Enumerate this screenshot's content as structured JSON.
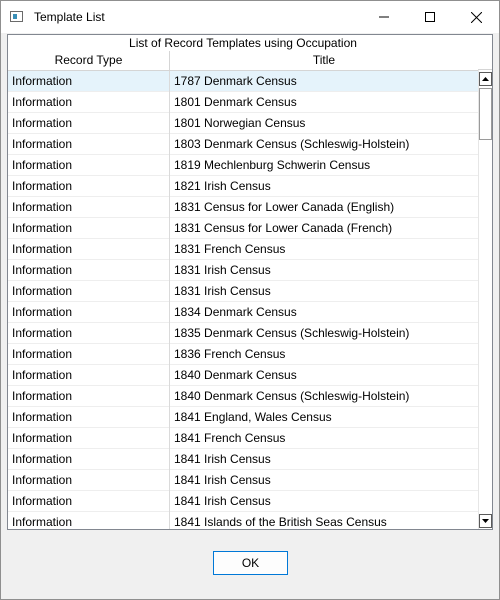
{
  "window": {
    "title": "Template List",
    "icon": "app-window-icon",
    "controls": {
      "minimize": "minimize-icon",
      "maximize": "maximize-icon",
      "close": "close-icon"
    }
  },
  "grid": {
    "group_header": "List of Record Templates using Occupation",
    "columns": [
      "Record Type",
      "Title"
    ],
    "selected_row_index": 0,
    "rows": [
      {
        "type": "Information",
        "title": "1787 Denmark Census"
      },
      {
        "type": "Information",
        "title": "1801 Denmark Census"
      },
      {
        "type": "Information",
        "title": "1801 Norwegian Census"
      },
      {
        "type": "Information",
        "title": "1803 Denmark Census (Schleswig-Holstein)"
      },
      {
        "type": "Information",
        "title": "1819 Mechlenburg Schwerin Census"
      },
      {
        "type": "Information",
        "title": "1821 Irish Census"
      },
      {
        "type": "Information",
        "title": "1831 Census for Lower Canada (English)"
      },
      {
        "type": "Information",
        "title": "1831 Census for Lower Canada (French)"
      },
      {
        "type": "Information",
        "title": "1831 French Census"
      },
      {
        "type": "Information",
        "title": "1831 Irish Census"
      },
      {
        "type": "Information",
        "title": "1831 Irish Census"
      },
      {
        "type": "Information",
        "title": "1834 Denmark Census"
      },
      {
        "type": "Information",
        "title": "1835 Denmark Census (Schleswig-Holstein)"
      },
      {
        "type": "Information",
        "title": "1836 French Census"
      },
      {
        "type": "Information",
        "title": "1840 Denmark Census"
      },
      {
        "type": "Information",
        "title": "1840 Denmark Census (Schleswig-Holstein)"
      },
      {
        "type": "Information",
        "title": "1841 England, Wales Census"
      },
      {
        "type": "Information",
        "title": "1841 French Census"
      },
      {
        "type": "Information",
        "title": "1841 Irish Census"
      },
      {
        "type": "Information",
        "title": "1841 Irish Census"
      },
      {
        "type": "Information",
        "title": "1841 Irish Census"
      },
      {
        "type": "Information",
        "title": "1841 Islands of the British Seas Census"
      }
    ],
    "scrollbar": {
      "up": "scroll-up-arrow-icon",
      "down": "scroll-down-arrow-icon"
    }
  },
  "footer": {
    "ok_label": "OK"
  },
  "colors": {
    "selected_row": "#e5f3fb",
    "accent": "#0078d7",
    "grid_border": "#828790"
  }
}
